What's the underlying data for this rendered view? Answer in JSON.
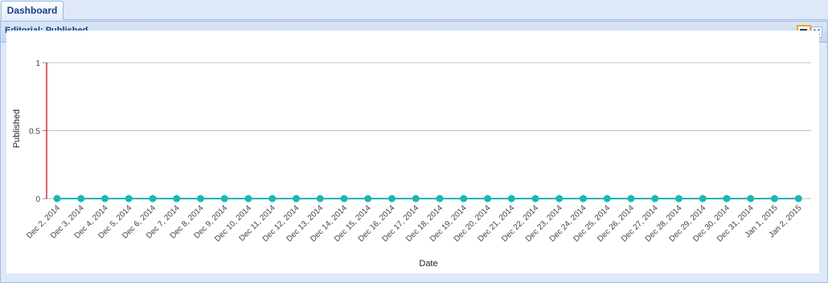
{
  "tabs": [
    {
      "label": "Dashboard"
    }
  ],
  "panel": {
    "title": "Editorial: Published"
  },
  "tools": {
    "maximize_icon": "maximize-icon",
    "close_icon": "close-icon"
  },
  "colors": {
    "series": "#1bb7b7",
    "axis": "#cc0000",
    "grid": "#c0c0c0",
    "header_text": "#15428b"
  },
  "chart_data": {
    "type": "line",
    "xlabel": "Date",
    "ylabel": "Published",
    "ylim": [
      0,
      1
    ],
    "yticks": [
      "0",
      "0.5",
      "1"
    ],
    "grid": true,
    "categories": [
      "Dec 2, 2014",
      "Dec 3, 2014",
      "Dec 4, 2014",
      "Dec 5, 2014",
      "Dec 6, 2014",
      "Dec 7, 2014",
      "Dec 8, 2014",
      "Dec 9, 2014",
      "Dec 10, 2014",
      "Dec 11, 2014",
      "Dec 12, 2014",
      "Dec 13, 2014",
      "Dec 14, 2014",
      "Dec 15, 2014",
      "Dec 16, 2014",
      "Dec 17, 2014",
      "Dec 18, 2014",
      "Dec 19, 2014",
      "Dec 20, 2014",
      "Dec 21, 2014",
      "Dec 22, 2014",
      "Dec 23, 2014",
      "Dec 24, 2014",
      "Dec 25, 2014",
      "Dec 26, 2014",
      "Dec 27, 2014",
      "Dec 28, 2014",
      "Dec 29, 2014",
      "Dec 30, 2014",
      "Dec 31, 2014",
      "Jan 1, 2015",
      "Jan 2, 2015"
    ],
    "series": [
      {
        "values": [
          0,
          0,
          0,
          0,
          0,
          0,
          0,
          0,
          0,
          0,
          0,
          0,
          0,
          0,
          0,
          0,
          0,
          0,
          0,
          0,
          0,
          0,
          0,
          0,
          0,
          0,
          0,
          0,
          0,
          0,
          0,
          0
        ]
      }
    ]
  }
}
